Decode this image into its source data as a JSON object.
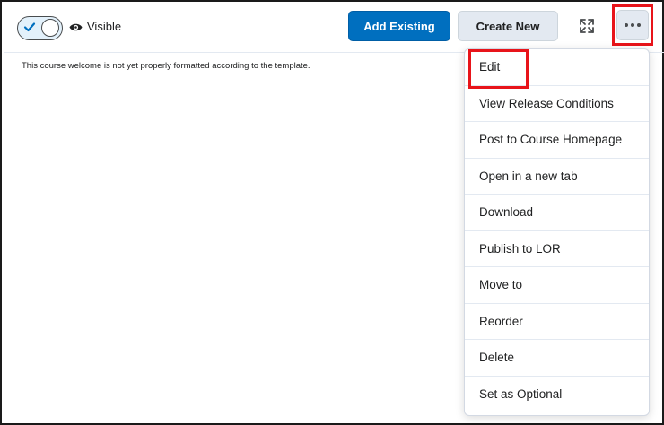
{
  "toolbar": {
    "visibility_label": "Visible",
    "visibility_on": true,
    "add_existing_label": "Add Existing",
    "create_new_label": "Create New",
    "icons": {
      "toggle": "check-icon",
      "visibility": "eye-icon",
      "fullscreen": "fullscreen-icon",
      "more": "more-options-icon"
    }
  },
  "content": {
    "welcome_text": "This course welcome is not yet properly formatted according to the template."
  },
  "menu": {
    "items": [
      {
        "label": "Edit"
      },
      {
        "label": "View Release Conditions"
      },
      {
        "label": "Post to Course Homepage"
      },
      {
        "label": "Open in a new tab"
      },
      {
        "label": "Download"
      },
      {
        "label": "Publish to LOR"
      },
      {
        "label": "Move to"
      },
      {
        "label": "Reorder"
      },
      {
        "label": "Delete"
      },
      {
        "label": "Set as Optional"
      }
    ]
  },
  "colors": {
    "primary": "#006fbf",
    "highlight": "#e8141a",
    "secondary_bg": "#e3e9f1"
  }
}
